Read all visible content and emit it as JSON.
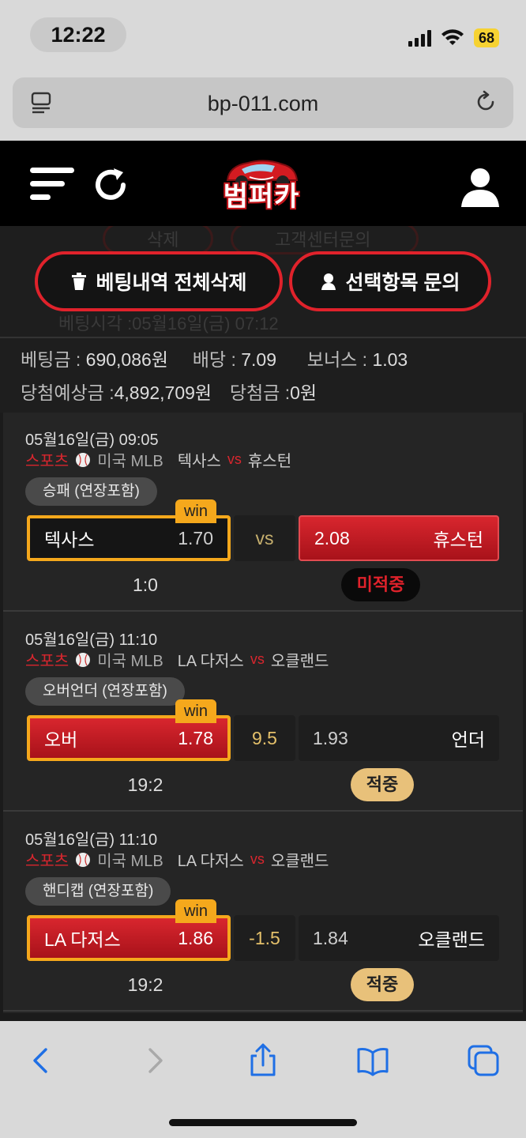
{
  "status_bar": {
    "time": "12:22",
    "battery": "68"
  },
  "browser": {
    "url": "bp-011.com"
  },
  "app": {
    "logo_text": "범퍼카"
  },
  "actions": {
    "delete_all": "베팅내역 전체삭제",
    "inquire_selected": "선택항목 문의",
    "ghost_delete": "삭제",
    "ghost_inquiry": "고객센터문의",
    "ghost_bet_time": "베팅시각 :05월16일(금) 07:12"
  },
  "summary": {
    "bet_amount_label": "베팅금 :",
    "bet_amount": "690,086원",
    "odds_label": "배당 :",
    "odds": "7.09",
    "bonus_label": "보너스 :",
    "bonus": "1.03",
    "expected_win_label": "당첨예상금 :",
    "expected_win": "4,892,709원",
    "win_amount_label": "당첨금 :",
    "win_amount": "0원"
  },
  "bets": [
    {
      "date": "05월16일(금) 09:05",
      "sport": "스포츠",
      "league": "미국 MLB",
      "home": "텍사스",
      "vs": "vs",
      "away": "휴스턴",
      "market": "승패 (연장포함)",
      "win_badge": "win",
      "home_odds": "1.70",
      "middle": "vs",
      "away_odds": "2.08",
      "score": "1:0",
      "result": "미적중"
    },
    {
      "date": "05월16일(금) 11:10",
      "sport": "스포츠",
      "league": "미국 MLB",
      "home": "LA 다저스",
      "vs": "vs",
      "away": "오클랜드",
      "market": "오버언더 (연장포함)",
      "win_badge": "win",
      "home_pick": "오버",
      "home_odds": "1.78",
      "middle": "9.5",
      "away_odds": "1.93",
      "away_pick": "언더",
      "score": "19:2",
      "result": "적중"
    },
    {
      "date": "05월16일(금) 11:10",
      "sport": "스포츠",
      "league": "미국 MLB",
      "home": "LA 다저스",
      "vs": "vs",
      "away": "오클랜드",
      "market": "핸디캡 (연장포함)",
      "win_badge": "win",
      "home_pick": "LA 다저스",
      "home_odds": "1.86",
      "middle": "-1.5",
      "away_odds": "1.84",
      "away_pick": "오클랜드",
      "score": "19:2",
      "result": "적중"
    }
  ]
}
